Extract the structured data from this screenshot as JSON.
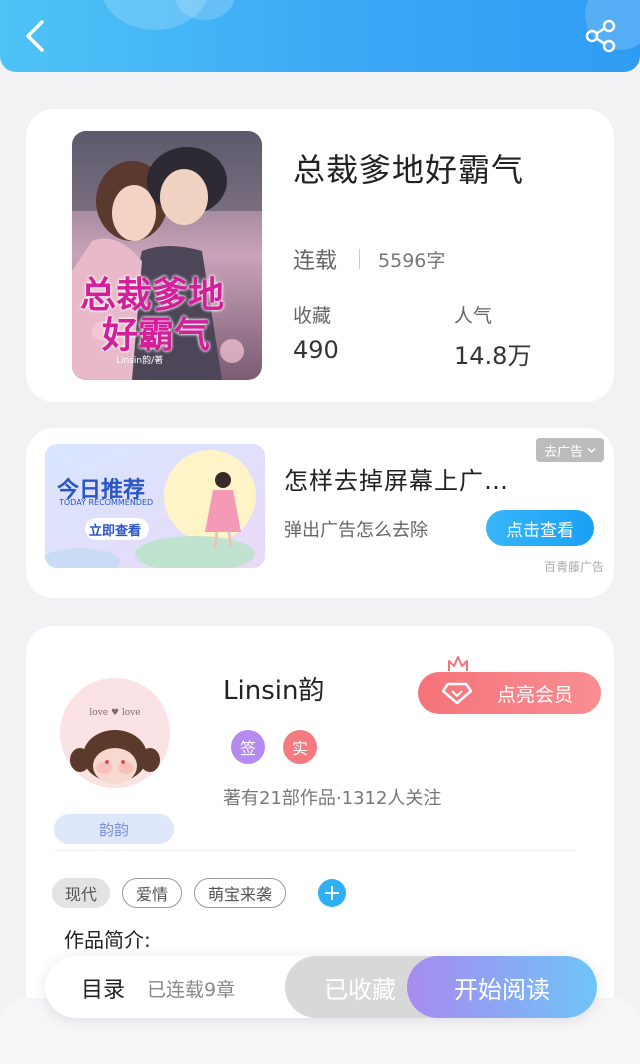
{
  "book": {
    "title": "总裁爹地好霸气",
    "status": "连载",
    "word_count": "5596字",
    "favorites_label": "收藏",
    "favorites_value": "490",
    "popularity_label": "人气",
    "popularity_value": "14.8万",
    "cover_title_line1": "总裁爹地",
    "cover_title_line2": "好霸气",
    "cover_author": "Linsin韵/著"
  },
  "ad": {
    "banner_title": "今日推荐",
    "banner_subtitle": "TODAY RECOMMENDED",
    "banner_button": "立即查看",
    "title": "怎样去掉屏幕上广…",
    "subtitle": "弹出广告怎么去除",
    "close_label": "去广告",
    "cta_label": "点击查看",
    "source": "百青藤广告"
  },
  "author": {
    "name": "Linsin韵",
    "avatar_tag": "韵韵",
    "avatar_text": "love ♥ love",
    "badges": [
      "签",
      "实"
    ],
    "stats": "著有21部作品·1312人关注",
    "vip_label": "点亮会员"
  },
  "tags": {
    "items": [
      "现代",
      "爱情",
      "萌宝来袭"
    ],
    "add_label": "+"
  },
  "intro": {
    "label": "作品简介:"
  },
  "bottom": {
    "toc_label": "目录",
    "toc_sub": "已连载9章",
    "collected_label": "已收藏",
    "read_label": "开始阅读"
  },
  "colors": {
    "header": "#3aa6f5",
    "accent_blue": "#2fb0f5",
    "vip_pink": "#f5737a",
    "badge_sign": "#b68af0",
    "badge_real": "#f57a80"
  },
  "icons": {
    "back": "chevron-left-icon",
    "share": "share-icon",
    "crown": "crown-icon",
    "diamond": "diamond-icon"
  }
}
